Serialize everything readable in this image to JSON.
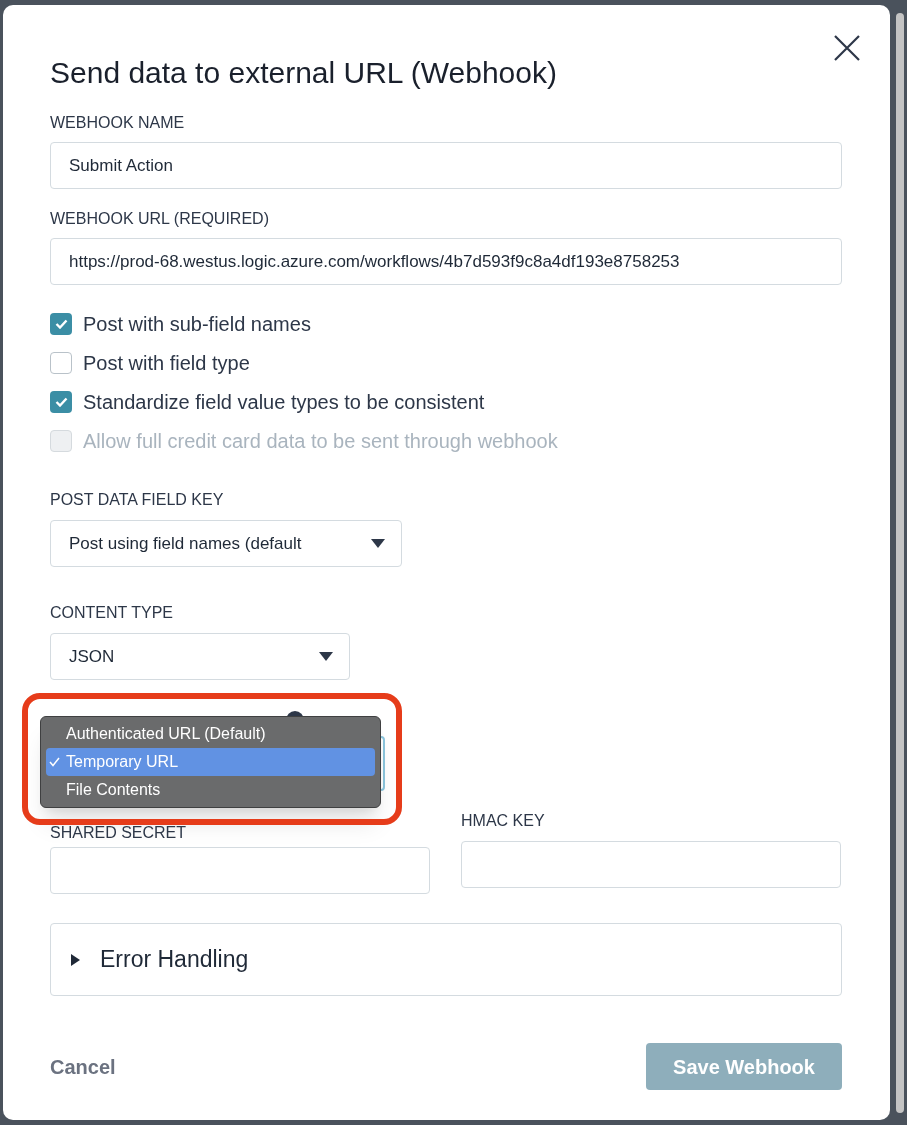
{
  "dialog": {
    "title": "Send data to external URL (Webhook)"
  },
  "text_fields": [
    {
      "label": "WEBHOOK NAME",
      "value": "Submit Action"
    },
    {
      "label": "WEBHOOK URL (REQUIRED)",
      "value": "https://prod-68.westus.logic.azure.com/workflows/4b7d593f9c8a4df193e8758253"
    }
  ],
  "checkboxes": [
    {
      "label": "Post with sub-field names",
      "checked": true,
      "disabled": false
    },
    {
      "label": "Post with field type",
      "checked": false,
      "disabled": false
    },
    {
      "label": "Standardize field value types to be consistent",
      "checked": true,
      "disabled": false
    },
    {
      "label": "Allow full credit card data to be sent through webhook",
      "checked": false,
      "disabled": true
    }
  ],
  "post_data_field_key": {
    "label": "POST DATA FIELD KEY",
    "value": "Post using field names (default"
  },
  "content_type": {
    "label": "CONTENT TYPE",
    "value": "JSON"
  },
  "file_signature_url_type": {
    "menu_open": true,
    "options": [
      {
        "label": "Authenticated URL (Default)",
        "selected": false
      },
      {
        "label": "Temporary URL",
        "selected": true
      },
      {
        "label": "File Contents",
        "selected": false
      }
    ]
  },
  "secret_fields": [
    {
      "label": "SHARED SECRET"
    },
    {
      "label": "HMAC KEY"
    }
  ],
  "error_handling": {
    "label": "Error Handling",
    "expanded": false
  },
  "footer": {
    "cancel": "Cancel",
    "save": "Save Webhook",
    "save_disabled": true
  }
}
